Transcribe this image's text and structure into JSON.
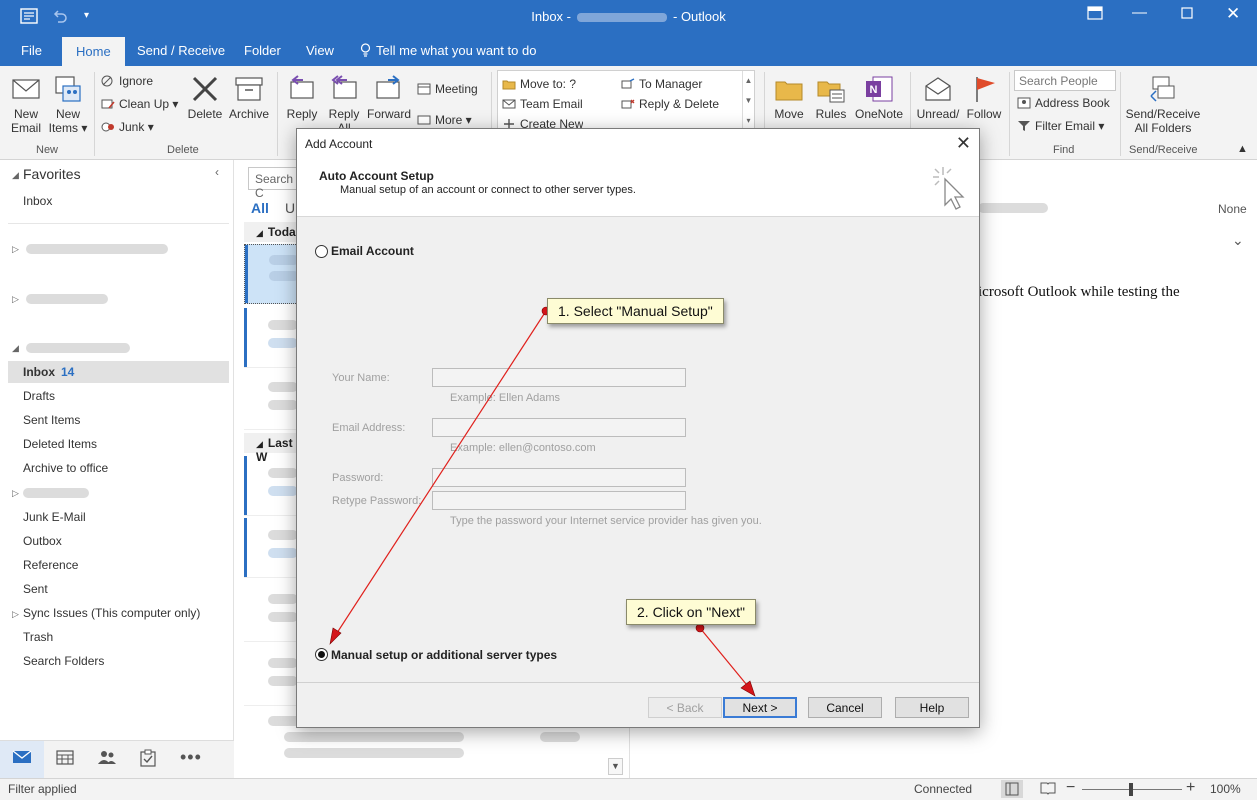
{
  "window": {
    "title_prefix": "Inbox -",
    "title_app": "- Outlook"
  },
  "tabs": [
    "File",
    "Home",
    "Send / Receive",
    "Folder",
    "View"
  ],
  "tell_me": "Tell me what you want to do",
  "ribbon": {
    "new_email": "New Email",
    "new_items": "New Items",
    "ignore": "Ignore",
    "clean_up": "Clean Up",
    "junk": "Junk",
    "delete": "Delete",
    "archive": "Archive",
    "reply": "Reply",
    "reply_all": "Reply All",
    "forward": "Forward",
    "meeting": "Meeting",
    "more": "More",
    "move_to": "Move to: ?",
    "team_email": "Team Email",
    "create_new": "Create New",
    "to_manager": "To Manager",
    "reply_delete": "Reply & Delete",
    "move": "Move",
    "rules": "Rules",
    "onenote": "OneNote",
    "unread": "Unread/",
    "follow": "Follow",
    "search_people": "Search People",
    "address_book": "Address Book",
    "filter_email": "Filter Email",
    "send_receive_all": "Send/Receive All Folders",
    "groups": {
      "new": "New",
      "delete": "Delete",
      "find": "Find",
      "send_receive": "Send/Receive"
    }
  },
  "nav": {
    "favorites": "Favorites",
    "fav_inbox": "Inbox",
    "inbox": "Inbox",
    "inbox_count": "14",
    "folders": [
      "Drafts",
      "Sent Items",
      "Deleted Items",
      "Archive to office"
    ],
    "folders2": [
      "Junk E-Mail",
      "Outbox",
      "Reference",
      "Sent",
      "Sync Issues (This computer only)",
      "Trash",
      "Search Folders"
    ]
  },
  "msglist": {
    "search": "Search C",
    "all": "All",
    "unread": "U",
    "today": "Toda",
    "last": "Last W"
  },
  "reading": {
    "none": "None",
    "body": "icrosoft Outlook while testing the"
  },
  "status": {
    "left": "Filter applied",
    "connected": "Connected",
    "zoom": "100%"
  },
  "dialog": {
    "title": "Add Account",
    "header_title": "Auto Account Setup",
    "header_sub": "Manual setup of an account or connect to other server types.",
    "email_account": "Email Account",
    "your_name": "Your Name:",
    "your_name_hint": "Example: Ellen Adams",
    "email_address": "Email Address:",
    "email_hint": "Example: ellen@contoso.com",
    "password": "Password:",
    "retype_password": "Retype Password:",
    "password_hint": "Type the password your Internet service provider has given you.",
    "manual_setup": "Manual setup or additional server types",
    "back": "< Back",
    "next": "Next >",
    "cancel": "Cancel",
    "help": "Help"
  },
  "callouts": {
    "one": "1. Select \"Manual Setup\"",
    "two": "2. Click on \"Next\""
  },
  "colors": {
    "accent": "#2b6fc2",
    "callout_bg": "#fefcd4",
    "arrow": "#e0201c"
  }
}
